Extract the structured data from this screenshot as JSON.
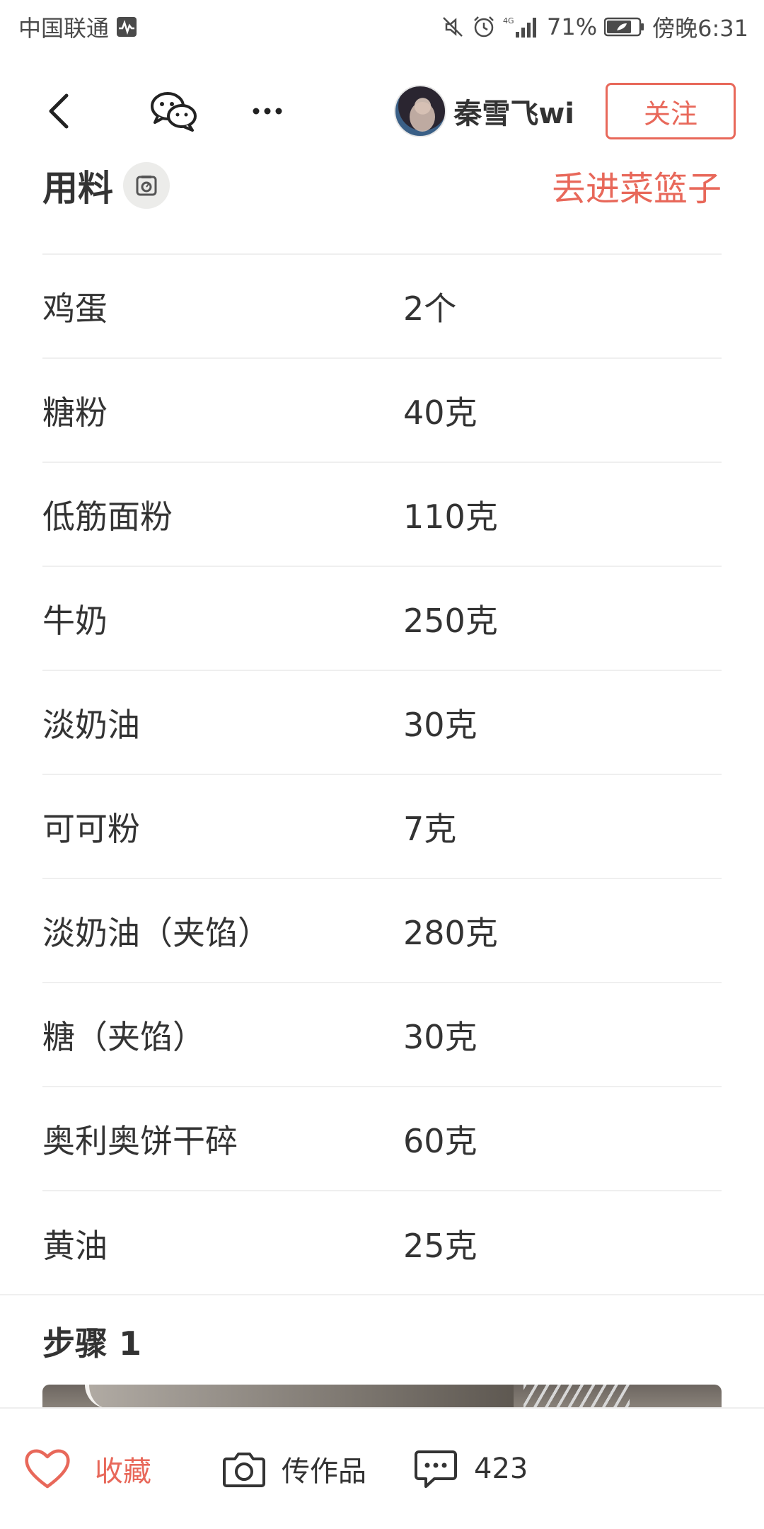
{
  "status_bar": {
    "carrier": "中国联通",
    "battery": "71%",
    "time": "傍晚6:31",
    "network": "4G"
  },
  "header": {
    "author_name": "秦雪飞wi",
    "follow_label": "关注"
  },
  "ingredients": {
    "title": "用料",
    "basket_label": "丢进菜篮子",
    "items": [
      {
        "name": "鸡蛋",
        "qty": "2个"
      },
      {
        "name": "糖粉",
        "qty": "40克"
      },
      {
        "name": "低筋面粉",
        "qty": "110克"
      },
      {
        "name": "牛奶",
        "qty": "250克"
      },
      {
        "name": "淡奶油",
        "qty": "30克"
      },
      {
        "name": "可可粉",
        "qty": "7克"
      },
      {
        "name": "淡奶油（夹馅）",
        "qty": "280克"
      },
      {
        "name": "糖（夹馅）",
        "qty": "30克"
      },
      {
        "name": "奥利奥饼干碎",
        "qty": "60克"
      },
      {
        "name": "黄油",
        "qty": "25克"
      }
    ]
  },
  "step": {
    "title": "步骤 1"
  },
  "bottom_bar": {
    "favorite_label": "收藏",
    "upload_label": "传作品",
    "comment_count": "423"
  },
  "colors": {
    "accent": "#e8685a",
    "text": "#333333",
    "divider": "#efefef"
  },
  "icons": [
    "activity-icon",
    "mute-icon",
    "alarm-icon",
    "signal-icon",
    "battery-icon",
    "back-icon",
    "wechat-icon",
    "more-icon",
    "scale-icon",
    "heart-icon",
    "camera-icon",
    "comment-icon"
  ]
}
